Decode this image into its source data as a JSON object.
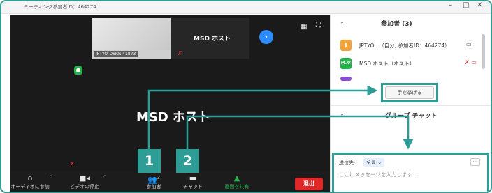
{
  "window": {
    "meeting_id_label": "ミーティング参加者ID：464274",
    "controls": [
      "–",
      "□",
      "✕"
    ]
  },
  "video": {
    "self_thumb_name": "JPTYO-DSRR-41873",
    "host_thumb_name": "MSD ホスト",
    "main_speaker_name": "MSD ホスト",
    "next_icon": "chevron-right-icon"
  },
  "toolbar": {
    "items": [
      {
        "label": "オーディオに参加",
        "icon": "headphone-icon"
      },
      {
        "label": "ビデオの停止",
        "icon": "video-camera-icon"
      },
      {
        "label": "参加者",
        "icon": "participants-icon",
        "count": "3"
      },
      {
        "label": "チャット",
        "icon": "chat-icon"
      },
      {
        "label": "画面を共有",
        "icon": "share-screen-icon"
      }
    ],
    "leave_label": "退出"
  },
  "badges": [
    "1",
    "2"
  ],
  "participants": {
    "title": "参加者 (3)",
    "rows": [
      {
        "initial": "J",
        "name": "JPTYO...（自分, 参加者ID：464274）",
        "color": "#f2a33a"
      },
      {
        "initial": "M.ホ",
        "name": "MSD ホスト（ホスト）",
        "color": "#23b24b"
      }
    ],
    "raise_hand_label": "手を挙げる"
  },
  "chat": {
    "title": "グループ チャット",
    "send_to_label": "送信先:",
    "send_to_value": "全員",
    "placeholder": "ここにメッセージを入力します…",
    "more_label": "···"
  },
  "colors": {
    "accent_teal": "#2e9d95",
    "leave_red": "#e02828",
    "share_green": "#23b24b",
    "mute_red": "#e23c3c"
  }
}
